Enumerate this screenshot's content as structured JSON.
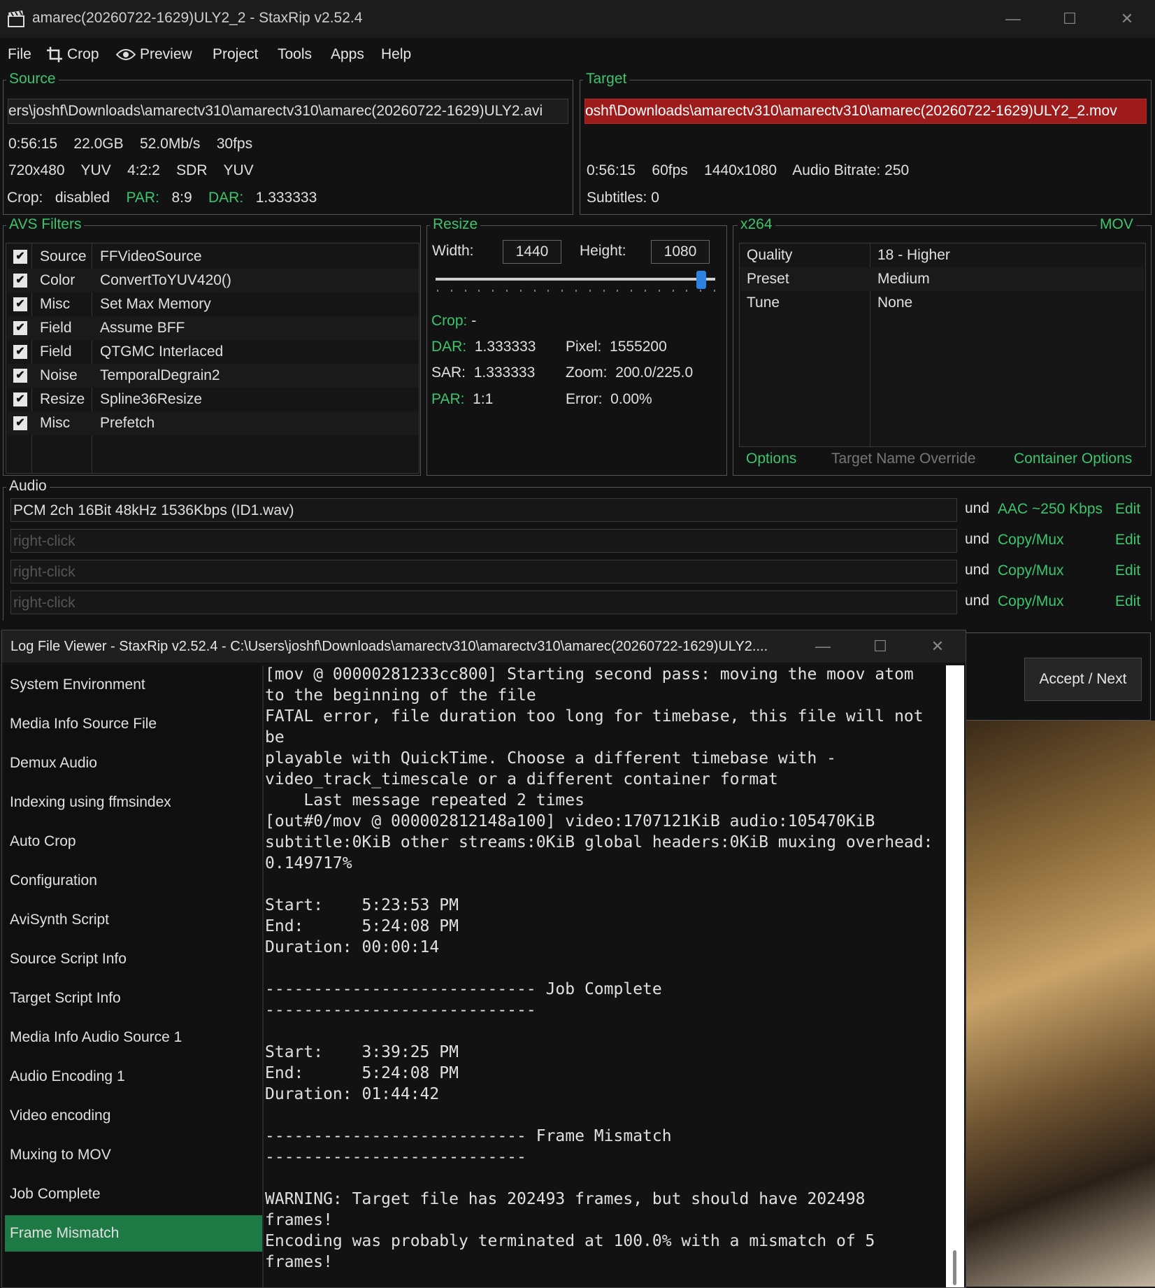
{
  "window": {
    "title": "amarec(20260722-1629)ULY2_2 - StaxRip v2.52.4",
    "minimize": "—",
    "maximize": "☐",
    "close": "✕"
  },
  "menu": {
    "file": "File",
    "crop": "Crop",
    "preview": "Preview",
    "project": "Project",
    "tools": "Tools",
    "apps": "Apps",
    "help": "Help"
  },
  "source": {
    "legend": "Source",
    "path": "ers\\joshf\\Downloads\\amarectv310\\amarectv310\\amarec(20260722-1629)ULY2.avi",
    "duration": "0:56:15",
    "size": "22.0GB",
    "bitrate": "52.0Mb/s",
    "fps": "30fps",
    "resolution": "720x480",
    "colorspace": "YUV",
    "subsampling": "4:2:2",
    "range": "SDR",
    "colorspace2": "YUV",
    "crop_label": "Crop:",
    "crop_value": "disabled",
    "par_label": "PAR:",
    "par_value": "8:9",
    "dar_label": "DAR:",
    "dar_value": "1.333333"
  },
  "target": {
    "legend": "Target",
    "path": "oshf\\Downloads\\amarectv310\\amarectv310\\amarec(20260722-1629)ULY2_2.mov",
    "path_color": "#9e1b1b",
    "duration": "0:56:15",
    "fps": "60fps",
    "resolution": "1440x1080",
    "audio_bitrate": "Audio Bitrate: 250",
    "subtitles": "Subtitles: 0"
  },
  "filters": {
    "legend": "AVS Filters",
    "items": [
      {
        "category": "Source",
        "name": "FFVideoSource",
        "checked": "✔"
      },
      {
        "category": "Color",
        "name": "ConvertToYUV420()",
        "checked": "✔"
      },
      {
        "category": "Misc",
        "name": "Set Max Memory",
        "checked": "✔"
      },
      {
        "category": "Field",
        "name": "Assume BFF",
        "checked": "✔"
      },
      {
        "category": "Field",
        "name": "QTGMC Interlaced",
        "checked": "✔"
      },
      {
        "category": "Noise",
        "name": "TemporalDegrain2",
        "checked": "✔"
      },
      {
        "category": "Resize",
        "name": "Spline36Resize",
        "checked": "✔"
      },
      {
        "category": "Misc",
        "name": "Prefetch",
        "checked": "✔"
      }
    ]
  },
  "resize": {
    "legend": "Resize",
    "width_label": "Width:",
    "width_value": "1440",
    "height_label": "Height:",
    "height_value": "1080",
    "slider_position": 0.95,
    "crop_label": "Crop:",
    "crop_value": "-",
    "dar_label": "DAR:",
    "dar_value": "1.333333",
    "sar_label": "SAR:",
    "sar_value": "1.333333",
    "par_label": "PAR:",
    "par_value": "1:1",
    "pixel_label": "Pixel:",
    "pixel_value": "1555200",
    "zoom_label": "Zoom:",
    "zoom_value": "200.0/225.0",
    "error_label": "Error:",
    "error_value": "0.00%"
  },
  "encoder": {
    "legend": "x264",
    "container": "MOV",
    "rows": [
      {
        "key": "Quality",
        "value": "18 - Higher"
      },
      {
        "key": "Preset",
        "value": "Medium"
      },
      {
        "key": "Tune",
        "value": "None"
      }
    ],
    "options": "Options",
    "target_name_override": "Target Name Override",
    "container_options": "Container Options"
  },
  "audio": {
    "legend": "Audio",
    "rows": [
      {
        "file": "PCM 2ch 16Bit 48kHz 1536Kbps (ID1.wav)",
        "lang": "und",
        "codec": "AAC ~250 Kbps",
        "edit": "Edit"
      },
      {
        "file": "right-click",
        "lang": "und",
        "codec": "Copy/Mux",
        "edit": "Edit"
      },
      {
        "file": "right-click",
        "lang": "und",
        "codec": "Copy/Mux",
        "edit": "Edit"
      },
      {
        "file": "right-click",
        "lang": "und",
        "codec": "Copy/Mux",
        "edit": "Edit"
      }
    ]
  },
  "accept_next": "Accept / Next",
  "log_viewer": {
    "title": "Log File Viewer - StaxRip v2.52.4 - C:\\Users\\joshf\\Downloads\\amarectv310\\amarectv310\\amarec(20260722-1629)ULY2....",
    "sections": [
      "System Environment",
      "Media Info Source File",
      "Demux Audio",
      "Indexing using ffmsindex",
      "Auto Crop",
      "Configuration",
      "AviSynth Script",
      "Source Script Info",
      "Target Script Info",
      "Media Info Audio Source 1",
      "Audio Encoding 1",
      "Video encoding",
      "Muxing to MOV",
      "Job Complete",
      "Frame Mismatch"
    ],
    "selected": "Frame Mismatch",
    "content": "[mov @ 00000281233cc800] Starting second pass: moving the moov atom\nto the beginning of the file\nFATAL error, file duration too long for timebase, this file will not\nbe\nplayable with QuickTime. Choose a different timebase with -\nvideo_track_timescale or a different container format\n    Last message repeated 2 times\n[out#0/mov @ 000002812148a100] video:1707121KiB audio:105470KiB\nsubtitle:0KiB other streams:0KiB global headers:0KiB muxing overhead:\n0.149717%\n\nStart:    5:23:53 PM\nEnd:      5:24:08 PM\nDuration: 00:00:14\n\n---------------------------- Job Complete\n----------------------------\n\nStart:    3:39:25 PM\nEnd:      5:24:08 PM\nDuration: 01:44:42\n\n--------------------------- Frame Mismatch\n---------------------------\n\nWARNING: Target file has 202493 frames, but should have 202498\nframes!\nEncoding was probably terminated at 100.0% with a mismatch of 5\nframes!"
  }
}
